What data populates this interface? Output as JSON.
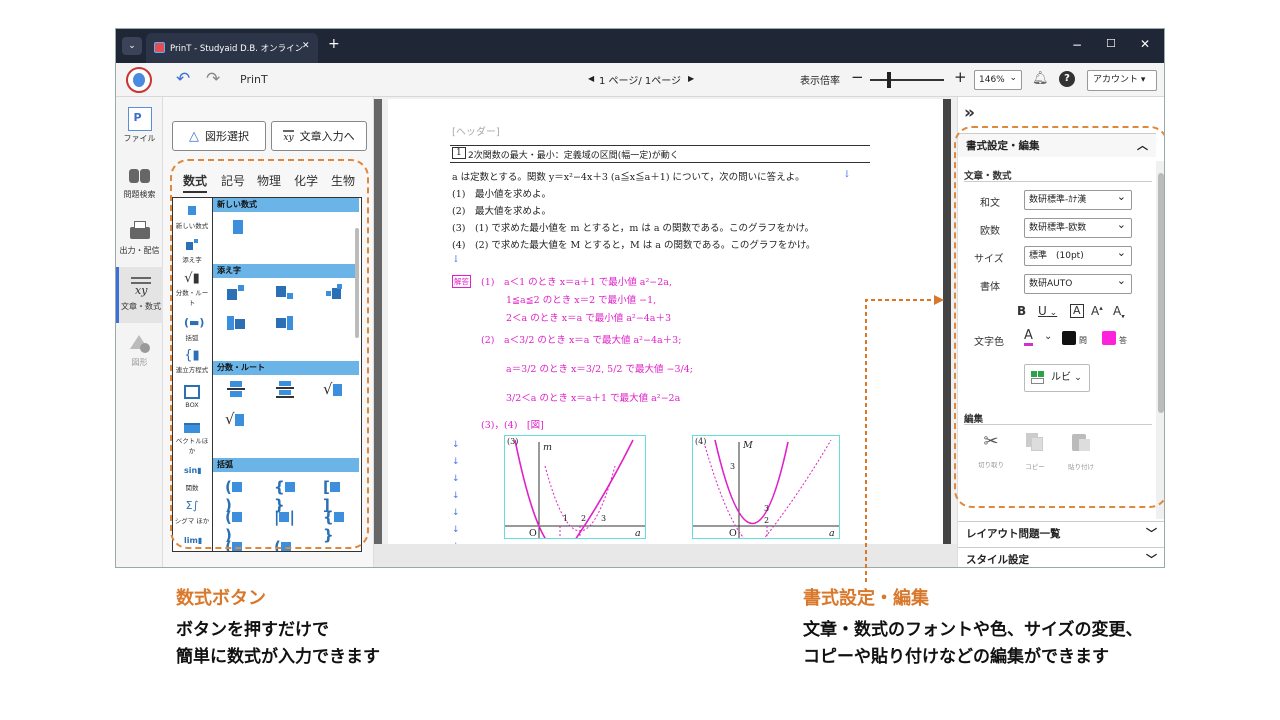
{
  "window": {
    "tab_title": "PrinT - Studyaid D.B. オンライン",
    "new_tab": "+",
    "minimize": "−",
    "maximize": "☐",
    "close": "✕"
  },
  "toolbar": {
    "app_name": "PrinT",
    "page_indicator": "1 ページ/ 1ページ",
    "zoom_label": "表示倍率",
    "zoom_minus": "−",
    "zoom_plus": "+",
    "zoom_value": "146%",
    "help": "?",
    "account": "アカウント"
  },
  "leftnav": {
    "items": [
      {
        "label": "ファイル",
        "icon": "file-icon"
      },
      {
        "label": "問題検索",
        "icon": "search-binoculars-icon"
      },
      {
        "label": "出力・配信",
        "icon": "printer-icon"
      },
      {
        "label": "文章・数式",
        "icon": "text-formula-icon"
      },
      {
        "label": "図形",
        "icon": "shapes-icon"
      }
    ]
  },
  "panel": {
    "shape_select": "図形選択",
    "text_input": "文章入力へ",
    "tabs": [
      "数式",
      "記号",
      "物理",
      "化学",
      "生物"
    ],
    "categories": [
      "新しい数式",
      "添え字",
      "分数・ルート",
      "括弧",
      "連立方程式",
      "BOX",
      "ベクトルほか",
      "関数",
      "シグマ ほか",
      "lim"
    ],
    "sections": [
      "新しい数式",
      "添え字",
      "分数・ルート",
      "括弧"
    ]
  },
  "document": {
    "header": "[ヘッダー]",
    "num": "1",
    "title": "2次関数の最大・最小：定義域の区間(幅一定)が動く",
    "problem": [
      "a は定数とする。関数 y＝x²−4x＋3 (a≦x≦a＋1) について，次の問いに答えよ。",
      "(1)　最小値を求めよ。",
      "(2)　最大値を求めよ。",
      "(3)　(1) で求めた最小値を m とすると，m は a の関数である。このグラフをかけ。",
      "(4)　(2) で求めた最大値を M とすると，M は a の関数である。このグラフをかけ。"
    ],
    "answer_tag": "解答",
    "answer": [
      "(1)　a＜1 のとき x＝a＋1 で最小値 a²−2a,",
      "1≦a≦2 のとき x＝2 で最小値 −1,",
      "2＜a のとき x＝a で最小値 a²−4a＋3",
      "(2)　a＜3/2 のとき x＝a で最大値 a²−4a＋3;",
      "a＝3/2 のとき x＝3/2, 5/2 で最大値 −3/4;",
      "3/2＜a のとき x＝a＋1 で最大値 a²−2a"
    ],
    "answer34": "(3)，(4)　[図]",
    "graph3": {
      "label": "(3)",
      "axis_y": "m",
      "axis_x": "a",
      "origin": "O",
      "ticks": [
        "1",
        "2",
        "3"
      ]
    },
    "graph4": {
      "label": "(4)",
      "axis_y": "M",
      "axis_x": "a",
      "origin": "O",
      "ticks": [
        "3",
        "3",
        "2"
      ]
    }
  },
  "rightpanel": {
    "collapse": "»",
    "format_edit": "書式設定・編集",
    "text_formula": "文章・数式",
    "wabun_label": "和文",
    "wabun_value": "数研標準-ｶﾅ漢",
    "obun_label": "欧数",
    "obun_value": "数研標準-欧数",
    "size_label": "サイズ",
    "size_value": "標準　(10pt)",
    "style_label": "書体",
    "style_value": "数研AUTO",
    "bold": "B",
    "underline": "U",
    "boxed": "A",
    "grow": "A",
    "shrink": "A",
    "color_label": "文字色",
    "color_a": "A",
    "q_label": "問",
    "ans_label": "答",
    "ruby": "ルビ",
    "edit_title": "編集",
    "cut": "切り取り",
    "copy": "コピー",
    "paste": "貼り付け",
    "layout_list": "レイアウト問題一覧",
    "style_settings": "スタイル設定",
    "colors": {
      "question": "#111111",
      "answer": "#ff22dd",
      "text": "#cc33cc"
    }
  },
  "captions": {
    "left_title": "数式ボタン",
    "left_body_1": "ボタンを押すだけで",
    "left_body_2": "簡単に数式が入力できます",
    "right_title": "書式設定・編集",
    "right_body_1": "文章・数式のフォントや色、サイズの変更、",
    "right_body_2": "コピーや貼り付けなどの編集ができます"
  },
  "accent_color": "#e0883a"
}
